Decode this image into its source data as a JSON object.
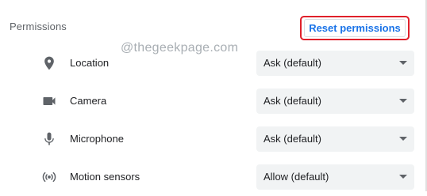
{
  "section": {
    "title": "Permissions",
    "reset_label": "Reset permissions"
  },
  "watermark": "@thegeekpage.com",
  "permissions": [
    {
      "label": "Location",
      "value": "Ask (default)",
      "icon": "location-pin-icon"
    },
    {
      "label": "Camera",
      "value": "Ask (default)",
      "icon": "camera-icon"
    },
    {
      "label": "Microphone",
      "value": "Ask (default)",
      "icon": "microphone-icon"
    },
    {
      "label": "Motion sensors",
      "value": "Allow (default)",
      "icon": "motion-sensors-icon"
    }
  ],
  "colors": {
    "accent": "#1a73e8",
    "highlight_border": "#e0202a",
    "select_bg": "#f1f3f4",
    "icon": "#5f6368"
  }
}
